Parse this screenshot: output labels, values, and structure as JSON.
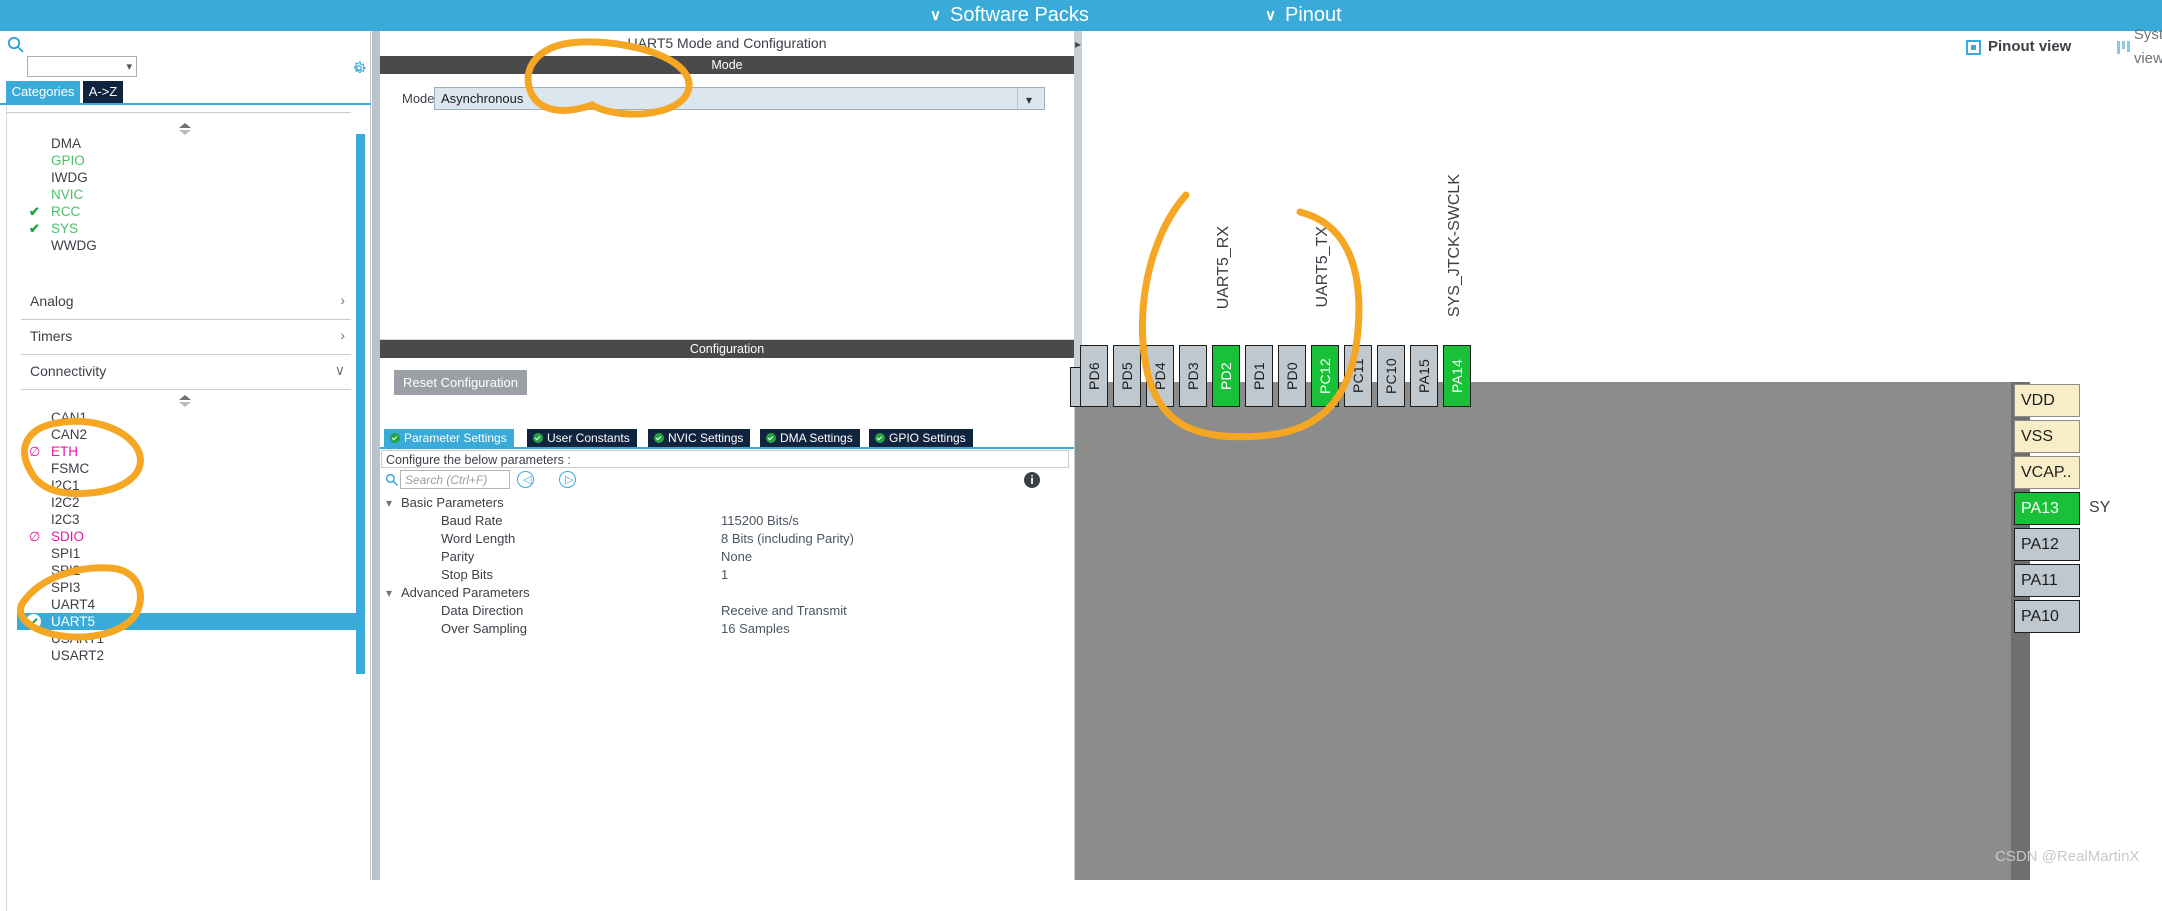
{
  "topbar": {
    "software_packs": "Software Packs",
    "pinout": "Pinout",
    "chevron": "∨"
  },
  "sidebar": {
    "search_placeholder": "",
    "search_value": "",
    "tabs": [
      {
        "label": "Categories",
        "selected": true
      },
      {
        "label": "A->Z",
        "selected": false
      }
    ],
    "system_items": [
      {
        "label": "DMA",
        "state": "plain"
      },
      {
        "label": "GPIO",
        "state": "green"
      },
      {
        "label": "IWDG",
        "state": "plain"
      },
      {
        "label": "NVIC",
        "state": "green"
      },
      {
        "label": "RCC",
        "state": "checked"
      },
      {
        "label": "SYS",
        "state": "checked"
      },
      {
        "label": "WWDG",
        "state": "plain"
      }
    ],
    "groups": [
      {
        "label": "Analog",
        "arrow": "›",
        "expanded": false
      },
      {
        "label": "Timers",
        "arrow": "›",
        "expanded": false
      },
      {
        "label": "Connectivity",
        "arrow": "∨",
        "expanded": true
      }
    ],
    "connectivity_items": [
      {
        "label": "CAN1",
        "state": "plain"
      },
      {
        "label": "CAN2",
        "state": "plain"
      },
      {
        "label": "ETH",
        "state": "blocked"
      },
      {
        "label": "FSMC",
        "state": "plain"
      },
      {
        "label": "I2C1",
        "state": "plain"
      },
      {
        "label": "I2C2",
        "state": "plain"
      },
      {
        "label": "I2C3",
        "state": "plain"
      },
      {
        "label": "SDIO",
        "state": "blocked"
      },
      {
        "label": "SPI1",
        "state": "plain"
      },
      {
        "label": "SPI2",
        "state": "plain"
      },
      {
        "label": "SPI3",
        "state": "plain"
      },
      {
        "label": "UART4",
        "state": "plain"
      },
      {
        "label": "UART5",
        "state": "selected-checked"
      },
      {
        "label": "USART1",
        "state": "plain"
      },
      {
        "label": "USART2",
        "state": "plain"
      }
    ],
    "icons": {
      "search": "search-icon",
      "gear": "gear-icon"
    }
  },
  "center": {
    "panel_title": "UART5 Mode and Configuration",
    "mode_bar": "Mode",
    "mode_label": "Mode",
    "mode_value": "Asynchronous",
    "configuration_bar": "Configuration",
    "reset_button": "Reset Configuration",
    "tabs": [
      {
        "label": "Parameter Settings",
        "selected": true
      },
      {
        "label": "User Constants",
        "selected": false
      },
      {
        "label": "NVIC Settings",
        "selected": false
      },
      {
        "label": "DMA Settings",
        "selected": false
      },
      {
        "label": "GPIO Settings",
        "selected": false
      }
    ],
    "configure_note": "Configure the below parameters :",
    "search_placeholder": "Search (Ctrl+F)",
    "search_value": "",
    "parameters": [
      {
        "kind": "group",
        "name": "Basic Parameters",
        "value": ""
      },
      {
        "kind": "param",
        "name": "Baud Rate",
        "value": "115200 Bits/s"
      },
      {
        "kind": "param",
        "name": "Word Length",
        "value": "8 Bits (including Parity)"
      },
      {
        "kind": "param",
        "name": "Parity",
        "value": "None"
      },
      {
        "kind": "param",
        "name": "Stop Bits",
        "value": "1"
      },
      {
        "kind": "group",
        "name": "Advanced Parameters",
        "value": ""
      },
      {
        "kind": "param",
        "name": "Data Direction",
        "value": "Receive and Transmit"
      },
      {
        "kind": "param",
        "name": "Over Sampling",
        "value": "16 Samples"
      }
    ]
  },
  "right": {
    "views": [
      {
        "label": "Pinout view",
        "selected": true,
        "icon": "chip-icon"
      },
      {
        "label": "System view",
        "selected": false,
        "icon": "grid-icon"
      }
    ],
    "signal_labels": [
      {
        "text": "UART5_RX",
        "pin": "PD2"
      },
      {
        "text": "UART5_TX",
        "pin": "PC12"
      },
      {
        "text": "SYS_JTCK-SWCLK",
        "pin": "PA13"
      }
    ],
    "bottom_pins": [
      {
        "label": "PD6",
        "state": "gray"
      },
      {
        "label": "PD5",
        "state": "gray"
      },
      {
        "label": "PD4",
        "state": "gray"
      },
      {
        "label": "PD3",
        "state": "gray"
      },
      {
        "label": "PD2",
        "state": "green"
      },
      {
        "label": "PD1",
        "state": "gray"
      },
      {
        "label": "PD0",
        "state": "gray"
      },
      {
        "label": "PC12",
        "state": "green"
      },
      {
        "label": "PC11",
        "state": "gray"
      },
      {
        "label": "PC10",
        "state": "gray"
      },
      {
        "label": "PA15",
        "state": "gray"
      },
      {
        "label": "PA14",
        "state": "green"
      }
    ],
    "right_pins": [
      {
        "label": "VDD",
        "state": "cream"
      },
      {
        "label": "VSS",
        "state": "cream"
      },
      {
        "label": "VCAP..",
        "state": "cream"
      },
      {
        "label": "PA13",
        "state": "green"
      },
      {
        "label": "PA12",
        "state": "gray"
      },
      {
        "label": "PA11",
        "state": "gray"
      },
      {
        "label": "PA10",
        "state": "gray"
      }
    ],
    "side_signal": "SY"
  },
  "watermark": "CSDN @RealMartinX",
  "colors": {
    "accent": "#3aaad8",
    "tab_dark": "#10243f",
    "green_pin": "#18c138",
    "cream_pin": "#f7eec8",
    "annotation": "#f5a623",
    "blocked": "#e8189e",
    "enabled_green": "#49c06a"
  }
}
